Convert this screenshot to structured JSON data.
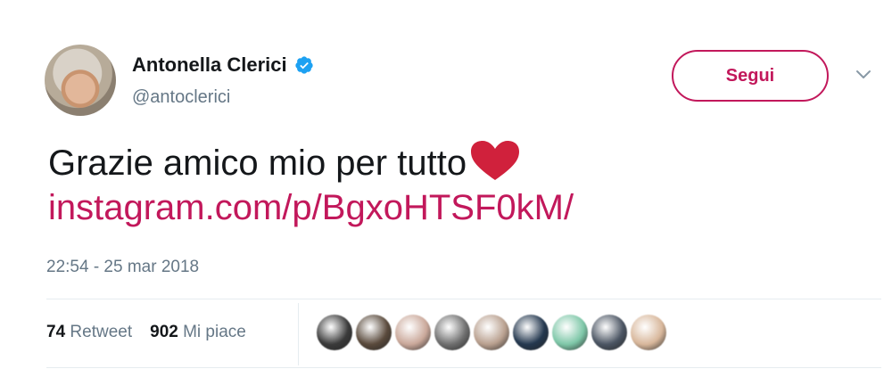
{
  "author": {
    "name": "Antonella Clerici",
    "handle": "@antoclerici",
    "verified": true
  },
  "follow_label": "Segui",
  "tweet": {
    "text": "Grazie amico mio per tutto",
    "link": "instagram.com/p/BgxoHTSF0kM/",
    "timestamp": "22:54 - 25 mar 2018"
  },
  "stats": {
    "retweets": "74",
    "retweet_label": "Retweet",
    "likes": "902",
    "likes_label": "Mi piace"
  },
  "colors": {
    "accent": "#c2185b",
    "verified": "#1da1f2",
    "heart": "#d0213c",
    "muted": "#657786"
  },
  "icons": [
    "verified-badge-icon",
    "chevron-down-icon",
    "heart-emoji-icon"
  ],
  "liker_avatars": [
    "#3a3a3a",
    "#5a4a3c",
    "#caa89a",
    "#6f6f6f",
    "#b9a08f",
    "#24384f",
    "#7ec7a8",
    "#4b5563",
    "#d8b79b"
  ]
}
